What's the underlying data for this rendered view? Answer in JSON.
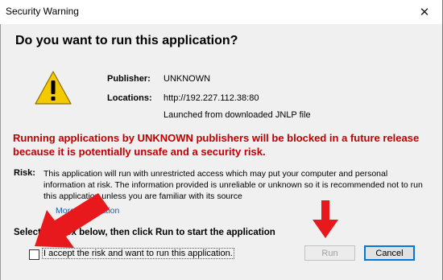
{
  "window": {
    "title": "Security Warning",
    "close_glyph": "✕"
  },
  "heading": "Do you want to run this application?",
  "info": {
    "publisher_label": "Publisher:",
    "publisher_value": "UNKNOWN",
    "locations_label": "Locations:",
    "locations_value": "http://192.227.112.38:80",
    "launched_note": "Launched from downloaded JNLP file"
  },
  "warning_text": "Running applications by UNKNOWN publishers will be blocked in a future release because it is potentially unsafe and a security risk.",
  "risk": {
    "label": "Risk:",
    "text": "This application will run with unrestricted access which may put your computer and personal information at risk. The information provided is unreliable or unknown so it is recommended not to run this application unless you are familiar with its source",
    "more_info": "More Information"
  },
  "instruction": "Select the box below, then click Run to start the application",
  "accept_checkbox": {
    "label": "I accept the risk and want to run this application.",
    "checked": false
  },
  "buttons": {
    "run": "Run",
    "cancel": "Cancel"
  },
  "colors": {
    "warning_red": "#c00000",
    "annotation_arrow": "#e8191c",
    "link_blue": "#1a5ea6",
    "focus_blue": "#0078d7"
  },
  "icons": [
    "warning-triangle-icon",
    "close-icon",
    "red-arrow-annotation"
  ]
}
